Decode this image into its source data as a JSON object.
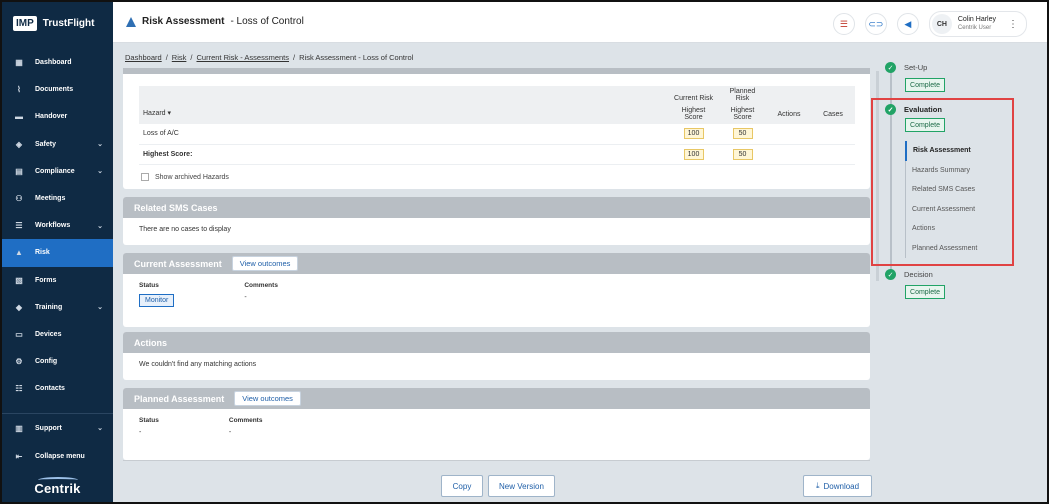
{
  "brand": {
    "logo": "IMP",
    "name": "TrustFlight",
    "footer": "Centrik"
  },
  "sidebar": {
    "items": [
      {
        "label": "Dashboard",
        "icon": "dashboard-icon",
        "glyph": "▦",
        "chevron": false
      },
      {
        "label": "Documents",
        "icon": "paperclip-icon",
        "glyph": "⌇",
        "chevron": false
      },
      {
        "label": "Handover",
        "icon": "inbox-icon",
        "glyph": "▬",
        "chevron": false
      },
      {
        "label": "Safety",
        "icon": "shield-icon",
        "glyph": "◈",
        "chevron": true
      },
      {
        "label": "Compliance",
        "icon": "clipboard-icon",
        "glyph": "▤",
        "chevron": true
      },
      {
        "label": "Meetings",
        "icon": "people-icon",
        "glyph": "⚇",
        "chevron": false
      },
      {
        "label": "Workflows",
        "icon": "workflow-icon",
        "glyph": "☰",
        "chevron": true
      },
      {
        "label": "Risk",
        "icon": "warning-icon",
        "glyph": "▲",
        "chevron": false,
        "active": true
      },
      {
        "label": "Forms",
        "icon": "form-icon",
        "glyph": "▧",
        "chevron": false
      },
      {
        "label": "Training",
        "icon": "graduation-icon",
        "glyph": "◆",
        "chevron": true
      },
      {
        "label": "Devices",
        "icon": "device-icon",
        "glyph": "▭",
        "chevron": false
      },
      {
        "label": "Config",
        "icon": "config-icon",
        "glyph": "⚙",
        "chevron": false
      },
      {
        "label": "Contacts",
        "icon": "contacts-icon",
        "glyph": "☷",
        "chevron": false
      }
    ],
    "support": "Support",
    "collapse": "Collapse menu"
  },
  "header": {
    "title_strong": "Risk Assessment",
    "title_rest": "- Loss of Control",
    "user_initials": "CH",
    "user_name": "Colin Harley",
    "user_role": "Centrik User"
  },
  "breadcrumb": [
    "Dashboard",
    "Risk",
    "Current Risk - Assessments",
    "Risk Assessment - Loss of Control"
  ],
  "hazards": {
    "col_current": "Current Risk",
    "col_planned": "Planned Risk",
    "col_hazard": "Hazard ▾",
    "col_highest": "Highest Score",
    "col_actions": "Actions",
    "col_cases": "Cases",
    "rows": [
      {
        "name": "Loss of A/C",
        "current": "100",
        "planned": "50"
      }
    ],
    "highest_label": "Highest Score:",
    "highest_current": "100",
    "highest_planned": "50",
    "show_archived": "Show archived Hazards"
  },
  "related": {
    "title": "Related SMS Cases",
    "empty": "There are no cases to display"
  },
  "current": {
    "title": "Current Assessment",
    "button": "View outcomes",
    "status_label": "Status",
    "status": "Monitor",
    "comments_label": "Comments",
    "comments": "-"
  },
  "actions": {
    "title": "Actions",
    "empty": "We couldn't find any matching actions"
  },
  "planned": {
    "title": "Planned Assessment",
    "button": "View outcomes",
    "status_label": "Status",
    "status": "-",
    "comments_label": "Comments",
    "comments": "-"
  },
  "footer": {
    "copy": "Copy",
    "new_version": "New Version",
    "download": "Download"
  },
  "stepper": {
    "setup": "Set-Up",
    "evaluation": "Evaluation",
    "decision": "Decision",
    "complete": "Complete",
    "sub_items": [
      "Risk Assessment",
      "Hazards Summary",
      "Related SMS Cases",
      "Current Assessment",
      "Actions",
      "Planned Assessment"
    ]
  },
  "colors": {
    "sidebar": "#0f2a44",
    "accent": "#1f6ec4",
    "success": "#21a366",
    "highlight": "#e04343"
  }
}
